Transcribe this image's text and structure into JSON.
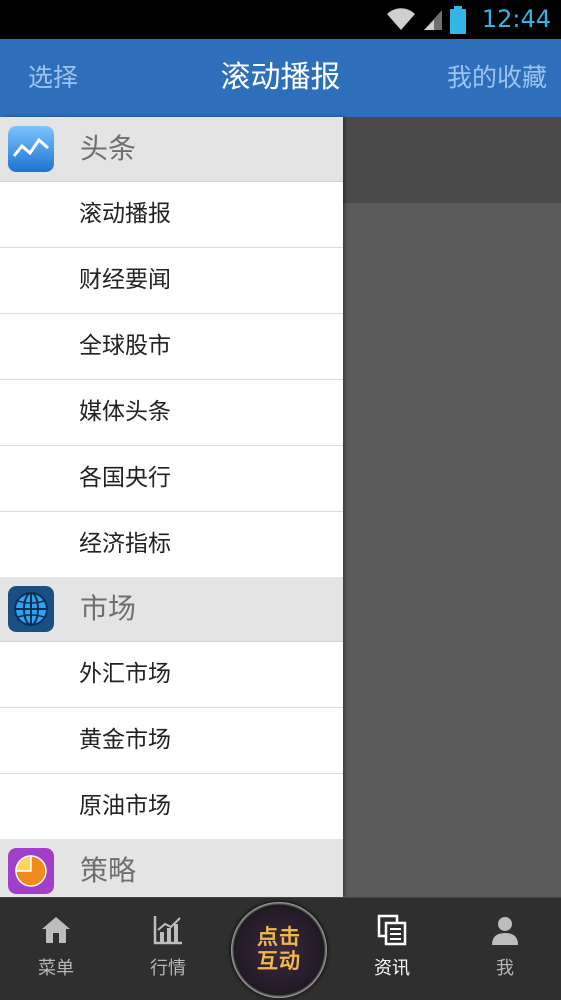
{
  "status_bar": {
    "time": "12:44"
  },
  "header": {
    "left_label": "选择",
    "title": "滚动播报",
    "right_label": "我的收藏"
  },
  "drawer": {
    "sections": [
      {
        "label": "头条",
        "icon": "stock-chart-icon",
        "items": [
          "滚动播报",
          "财经要闻",
          "全球股市",
          "媒体头条",
          "各国央行",
          "经济指标"
        ]
      },
      {
        "label": "市场",
        "icon": "globe-icon",
        "items": [
          "外汇市场",
          "黄金市场",
          "原油市场"
        ]
      },
      {
        "label": "策略",
        "icon": "pie-chart-icon",
        "items": []
      }
    ]
  },
  "tabbar": {
    "menu_label": "菜单",
    "quotes_label": "行情",
    "center_line1": "点击",
    "center_line2": "互动",
    "news_label": "资讯",
    "me_label": "我"
  },
  "colors": {
    "header_bg": "#2d6fbb",
    "status_time": "#33b5e5",
    "center_text": "#f0b84a"
  }
}
